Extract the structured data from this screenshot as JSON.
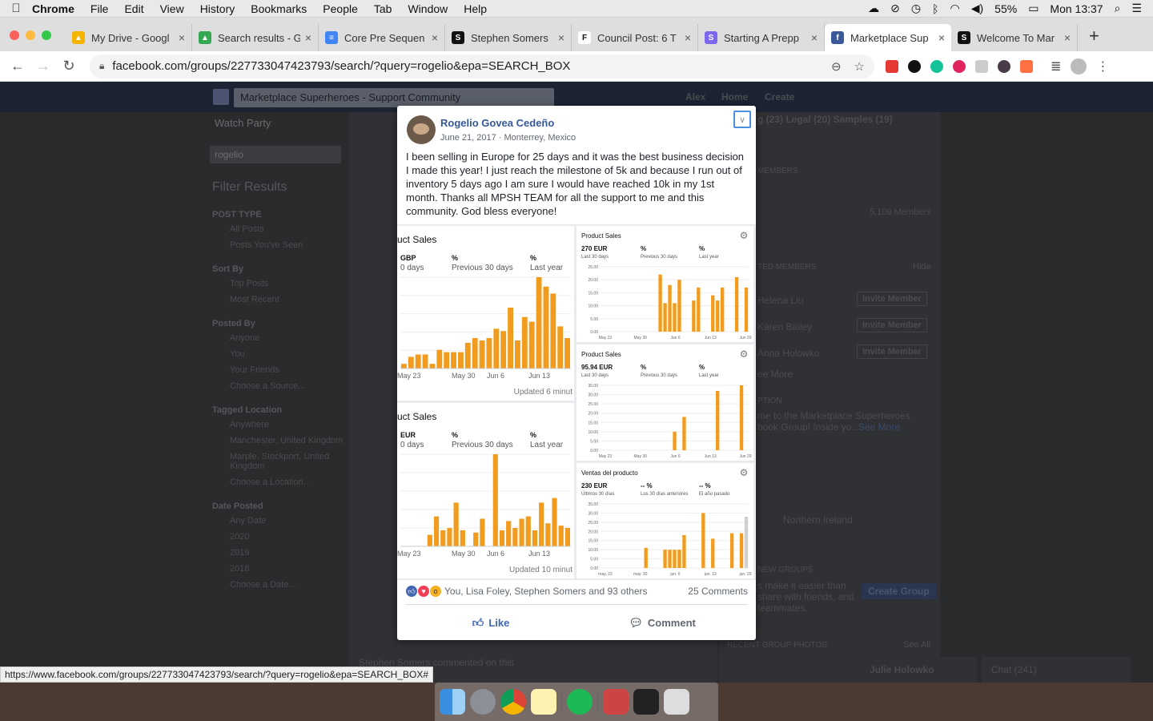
{
  "menubar": {
    "app": "Chrome",
    "items": [
      "File",
      "Edit",
      "View",
      "History",
      "Bookmarks",
      "People",
      "Tab",
      "Window",
      "Help"
    ],
    "battery": "55%",
    "clock": "Mon 13:37"
  },
  "tabs": [
    {
      "title": "My Drive - Googl",
      "color": "#f4b400",
      "glyph": "▲"
    },
    {
      "title": "Search results - G",
      "color": "#34a853",
      "glyph": "▲"
    },
    {
      "title": "Core Pre Sequen",
      "color": "#4285f4",
      "glyph": "≡"
    },
    {
      "title": "Stephen Somers",
      "color": "#111111",
      "glyph": "S"
    },
    {
      "title": "Council Post: 6 T",
      "color": "#ffffff",
      "glyph": "F"
    },
    {
      "title": "Starting A Prepp",
      "color": "#7b68ee",
      "glyph": "S"
    },
    {
      "title": "Marketplace Sup",
      "color": "#3b5998",
      "glyph": "f"
    },
    {
      "title": "Welcome To Mar",
      "color": "#111111",
      "glyph": "S"
    }
  ],
  "address": {
    "url": "facebook.com/groups/227733047423793/search/?query=rogelio&epa=SEARCH_BOX"
  },
  "background": {
    "group_search": "Marketplace Superheroes - Support Community",
    "user": "Alex",
    "home": "Home",
    "create": "Create",
    "watch_party": "Watch Party",
    "search_value": "rogelio",
    "filter_title": "Filter Results",
    "sections": [
      {
        "title": "POST TYPE",
        "items": [
          "All Posts",
          "Posts You've Seen"
        ]
      },
      {
        "title": "Sort By",
        "items": [
          "Top Posts",
          "Most Recent"
        ]
      },
      {
        "title": "Posted By",
        "items": [
          "Anyone",
          "You",
          "Your Friends",
          "Choose a Source..."
        ]
      },
      {
        "title": "Tagged Location",
        "items": [
          "Anywhere",
          "Manchester, United Kingdom",
          "Marple, Stockport, United Kingdom",
          "Choose a Location..."
        ]
      },
      {
        "title": "Date Posted",
        "items": [
          "Any Date",
          "2020",
          "2019",
          "2018",
          "Choose a Date..."
        ]
      }
    ],
    "right_tabs": "g (23)   Legal (20)   Samples (19)",
    "members_heading": "MEMBERS",
    "member_count": "5,109 Members",
    "suggested": "TED MEMBERS",
    "hide": "Hide",
    "suggested_people": [
      "Helena Liu",
      "Karen Bailey",
      "Anna Holowko"
    ],
    "invite": "Invite Member",
    "see_more": "ee More",
    "description_heading": "PTION",
    "description": "me to the Marketplace Superheroes book Group! Inside yo...",
    "see_more_link": "See More",
    "location": "Northern Ireland",
    "new_groups": "NEW GROUPS",
    "new_groups_text": "s make it easier than share with friends, and teammates.",
    "create_group": "Create Group",
    "recent_photos": "RECENT GROUP PHOTOS",
    "see_all": "See All",
    "chat_person": "Julie Holowko",
    "chat": "Chat (241)",
    "commented": "Stephen Somers commented on this"
  },
  "post": {
    "author": "Rogelio Govea Cedeño",
    "meta": "June 21, 2017 · Monterrey, Mexico",
    "text": "I been selling in Europe for 25 days and it was the best business decision I made this year! I just reach the milestone of 5k and because I run out of inventory 5 days ago I am sure I would have reached 10k in my 1st month. Thanks all MPSH TEAM for all the support to me and this community. God bless everyone!",
    "reactions_text": "You, Lisa Foley, Stephen Somers and 93 others",
    "comments": "25 Comments",
    "like_label": "Like",
    "comment_label": "Comment"
  },
  "chart_data": [
    {
      "type": "bar",
      "title": "uct Sales",
      "stats": [
        "GBP",
        "%",
        "%"
      ],
      "stat_labels": [
        "0 days",
        "Previous 30 days",
        "Last year"
      ],
      "categories": [
        "May 23",
        "May 30",
        "Jun 6",
        "Jun 13"
      ],
      "values": [
        2,
        5,
        6,
        6,
        2,
        8,
        7,
        7,
        7,
        11,
        13,
        12,
        13,
        17,
        16,
        26,
        12,
        22,
        20,
        39,
        35,
        32,
        18,
        13
      ],
      "footer": "Updated 6 minut",
      "color": "#f29c1f"
    },
    {
      "type": "bar",
      "title": "uct Sales",
      "stats": [
        "EUR",
        "%",
        "%"
      ],
      "stat_labels": [
        "0 days",
        "Previous 30 days",
        "Last year"
      ],
      "categories": [
        "May 23",
        "May 30",
        "Jun 6",
        "Jun 13"
      ],
      "values": [
        0,
        0,
        0,
        0,
        5,
        13,
        7,
        8,
        19,
        7,
        0,
        6,
        12,
        0,
        40,
        7,
        11,
        8,
        12,
        13,
        7,
        19,
        10,
        21,
        9,
        8
      ],
      "footer": "Updated 10 minut",
      "color": "#f29c1f"
    },
    {
      "type": "bar",
      "title": "Product Sales",
      "stats": [
        "270 EUR",
        "%",
        "%"
      ],
      "stat_labels": [
        "Last 30 days",
        "Previous 30 days",
        "Last year"
      ],
      "yticks": [
        "25.00",
        "20.00",
        "15.00",
        "10.00",
        "5.00",
        "0.00"
      ],
      "categories": [
        "May 23",
        "May 30",
        "Jun 6",
        "Jun 13",
        "Jun 20"
      ],
      "values": [
        0,
        0,
        0,
        0,
        0,
        0,
        0,
        0,
        0,
        0,
        0,
        0,
        22,
        11,
        18,
        11,
        20,
        0,
        0,
        12,
        17,
        0,
        0,
        14,
        12,
        17,
        0,
        0,
        21,
        0,
        17
      ],
      "ylim": [
        0,
        25
      ],
      "color": "#f29c1f"
    },
    {
      "type": "bar",
      "title": "Product Sales",
      "stats": [
        "95.94 EUR",
        "%",
        "%"
      ],
      "stat_labels": [
        "Last 30 days",
        "Previous 30 days",
        "Last year"
      ],
      "yticks": [
        "35.00",
        "30.00",
        "25.00",
        "20.00",
        "15.00",
        "10.00",
        "5.00",
        "0.00"
      ],
      "categories": [
        "May 23",
        "May 30",
        "Jun 6",
        "Jun 13",
        "Jun 20"
      ],
      "values": [
        0,
        0,
        0,
        0,
        0,
        0,
        0,
        0,
        0,
        0,
        0,
        0,
        0,
        0,
        0,
        10,
        0,
        18,
        0,
        0,
        0,
        0,
        0,
        0,
        32,
        0,
        0,
        0,
        0,
        35,
        0
      ],
      "ylim": [
        0,
        35
      ],
      "color": "#f29c1f"
    },
    {
      "type": "bar",
      "title": "Ventas del producto",
      "stats": [
        "230 EUR",
        "-- %",
        "-- %"
      ],
      "stat_labels": [
        "Últimos 30 días",
        "Los 30 días anteriores",
        "El año pasado"
      ],
      "yticks": [
        "35.00",
        "30.00",
        "25.00",
        "20.00",
        "15.00",
        "10.00",
        "5.00",
        "0.00"
      ],
      "categories": [
        "may. 23",
        "may. 30",
        "jun. 6",
        "jun. 13",
        "jun. 20"
      ],
      "values": [
        0,
        0,
        0,
        0,
        0,
        0,
        0,
        0,
        0,
        11,
        0,
        0,
        0,
        10,
        10,
        10,
        10,
        18,
        0,
        0,
        0,
        30,
        0,
        16,
        0,
        0,
        0,
        19,
        0,
        19,
        28
      ],
      "ylim": [
        0,
        35
      ],
      "color": "#f29c1f"
    }
  ],
  "status_bar": "https://www.facebook.com/groups/227733047423793/search/?query=rogelio&epa=SEARCH_BOX#"
}
